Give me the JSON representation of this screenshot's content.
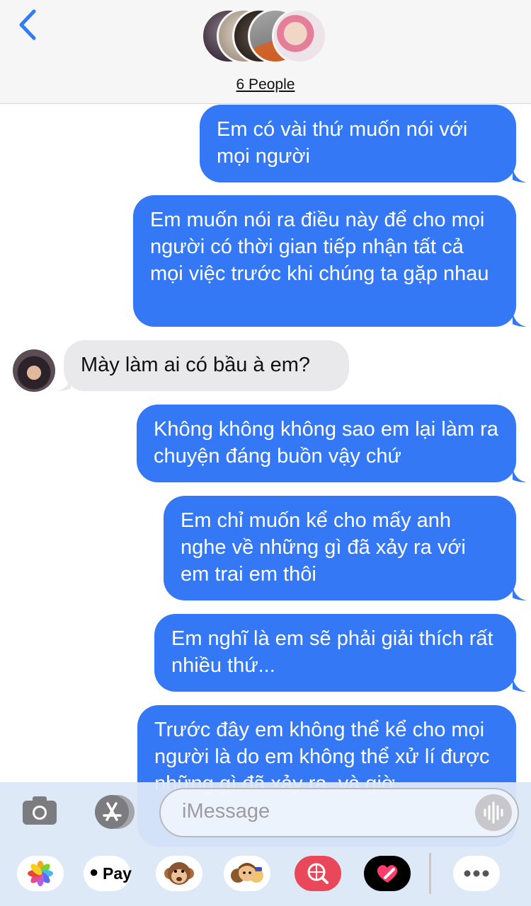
{
  "header": {
    "participants_label": "6 People"
  },
  "messages": [
    {
      "dir": "out",
      "text": "Em có vài thứ muốn nói với mọi người"
    },
    {
      "dir": "out",
      "text": "Em muốn nói ra điều này để cho mọi người có thời gian tiếp nhận tất cả mọi việc trước khi chúng ta gặp nhau"
    },
    {
      "dir": "in",
      "text": "Mày làm ai có bầu à em?"
    },
    {
      "dir": "out",
      "text": "Không không không sao em lại làm ra chuyện đáng buồn vậy chứ"
    },
    {
      "dir": "out",
      "text": "Em chỉ muốn kể cho mấy anh nghe về những gì đã xảy ra với em trai em thôi"
    },
    {
      "dir": "out",
      "text": "Em nghĩ là em sẽ phải giải thích rất nhiều thứ..."
    },
    {
      "dir": "out",
      "text": "Trước đây em không thể kể cho mọi người là do em không thể xử lí được những gì đã xảy ra, và giờ"
    }
  ],
  "composer": {
    "placeholder": "iMessage"
  },
  "apps": {
    "apple_pay_label": "Pay"
  },
  "colors": {
    "outgoing": "#3478f6",
    "incoming": "#e9e9eb",
    "accent": "#2f7cf6"
  }
}
